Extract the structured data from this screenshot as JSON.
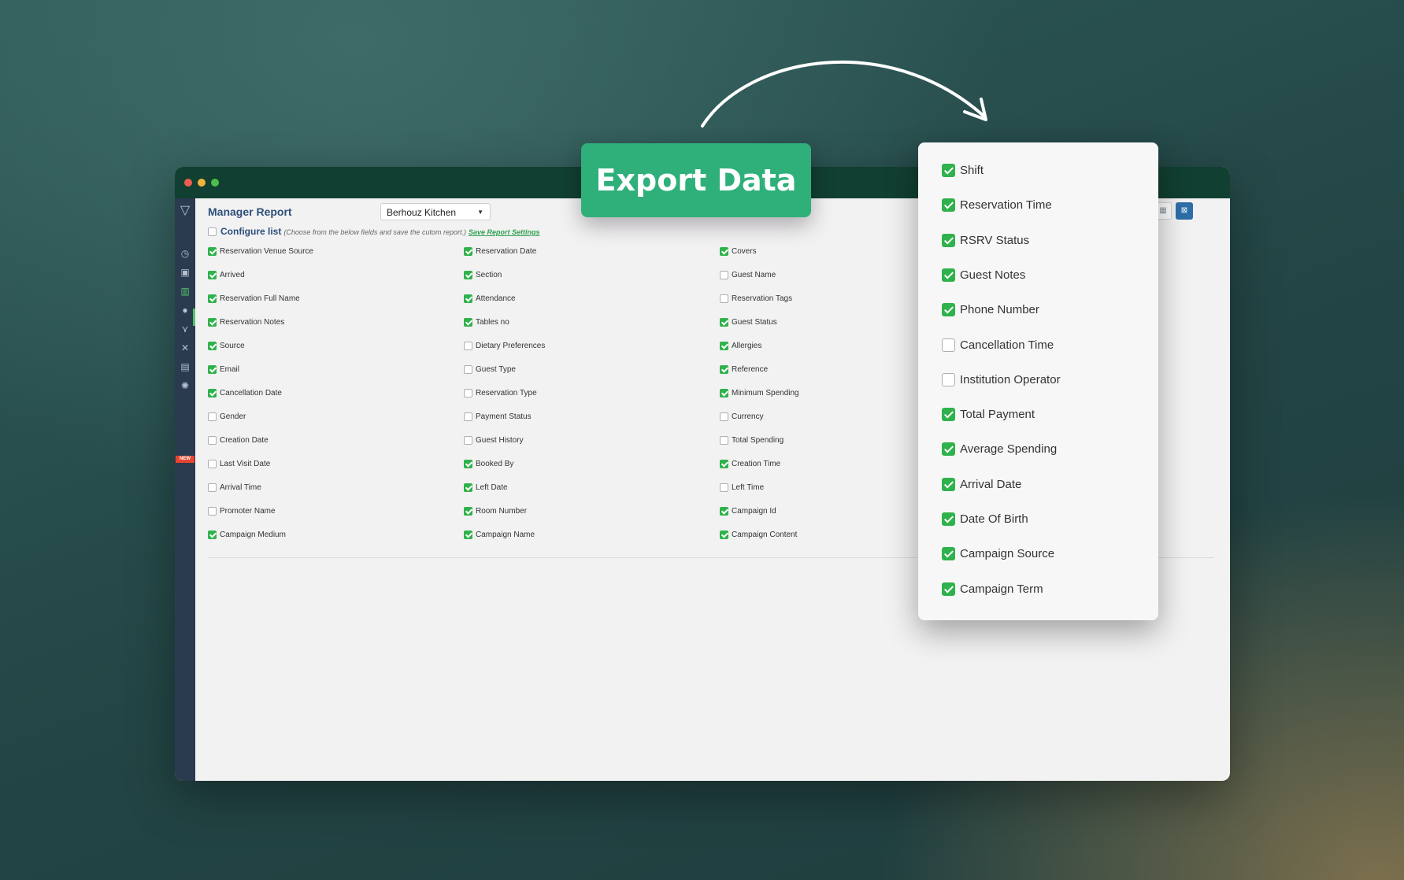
{
  "headline": {
    "label": "Export Data"
  },
  "report": {
    "title": "Manager Report",
    "venue": {
      "selected": "Berhouz Kitchen"
    },
    "configure": {
      "label": "Configure list",
      "hint": "(Choose from the below fields and save the cutom report.)",
      "save_link": "Save Report Settings",
      "checked": false
    },
    "columns": [
      [
        {
          "label": "Reservation Venue Source",
          "checked": true
        },
        {
          "label": "Arrived",
          "checked": true
        },
        {
          "label": "Reservation Full Name",
          "checked": true
        },
        {
          "label": "Reservation Notes",
          "checked": true
        },
        {
          "label": "Source",
          "checked": true
        },
        {
          "label": "Email",
          "checked": true
        },
        {
          "label": "Cancellation Date",
          "checked": true
        },
        {
          "label": "Gender",
          "checked": false
        },
        {
          "label": "Creation Date",
          "checked": false
        },
        {
          "label": "Last Visit Date",
          "checked": false
        },
        {
          "label": "Arrival Time",
          "checked": false
        },
        {
          "label": "Promoter Name",
          "checked": false
        },
        {
          "label": "Campaign Medium",
          "checked": true
        }
      ],
      [
        {
          "label": "Reservation Date",
          "checked": true
        },
        {
          "label": "Section",
          "checked": true
        },
        {
          "label": "Attendance",
          "checked": true
        },
        {
          "label": "Tables no",
          "checked": true
        },
        {
          "label": "Dietary Preferences",
          "checked": false
        },
        {
          "label": "Guest Type",
          "checked": false
        },
        {
          "label": "Reservation Type",
          "checked": false
        },
        {
          "label": "Payment Status",
          "checked": false
        },
        {
          "label": "Guest History",
          "checked": false
        },
        {
          "label": "Booked By",
          "checked": true
        },
        {
          "label": "Left Date",
          "checked": true
        },
        {
          "label": "Room Number",
          "checked": true
        },
        {
          "label": "Campaign Name",
          "checked": true
        }
      ],
      [
        {
          "label": "Covers",
          "checked": true
        },
        {
          "label": "Guest Name",
          "checked": false
        },
        {
          "label": "Reservation Tags",
          "checked": false
        },
        {
          "label": "Guest Status",
          "checked": true
        },
        {
          "label": "Allergies",
          "checked": true
        },
        {
          "label": "Reference",
          "checked": true
        },
        {
          "label": "Minimum Spending",
          "checked": true
        },
        {
          "label": "Currency",
          "checked": false
        },
        {
          "label": "Total Spending",
          "checked": false
        },
        {
          "label": "Creation Time",
          "checked": true
        },
        {
          "label": "Left Time",
          "checked": false
        },
        {
          "label": "Campaign Id",
          "checked": true
        },
        {
          "label": "Campaign Content",
          "checked": true
        }
      ]
    ]
  },
  "popup": {
    "items": [
      {
        "label": "Shift",
        "checked": true
      },
      {
        "label": "Reservation Time",
        "checked": true
      },
      {
        "label": "RSRV Status",
        "checked": true
      },
      {
        "label": "Guest Notes",
        "checked": true
      },
      {
        "label": "Phone Number",
        "checked": true
      },
      {
        "label": "Cancellation Time",
        "checked": false
      },
      {
        "label": "Institution Operator",
        "checked": false
      },
      {
        "label": "Total Payment",
        "checked": true
      },
      {
        "label": "Average Spending",
        "checked": true
      },
      {
        "label": "Arrival Date",
        "checked": true
      },
      {
        "label": "Date Of Birth",
        "checked": true
      },
      {
        "label": "Campaign Source",
        "checked": true
      },
      {
        "label": "Campaign Term",
        "checked": true
      }
    ]
  },
  "sidebar": {
    "icons": [
      "logo-icon",
      "clock-icon",
      "calendar-icon",
      "reports-icon",
      "user-icon",
      "routes-icon",
      "tools-icon",
      "document-icon",
      "settings-icon"
    ],
    "new_badge": "NEW"
  },
  "colors": {
    "accent_green": "#2fb07a",
    "checkbox_green": "#2fb24b",
    "titlebar": "#113f31",
    "sidebar": "#2b3b4f",
    "link_green": "#2fa14f"
  }
}
